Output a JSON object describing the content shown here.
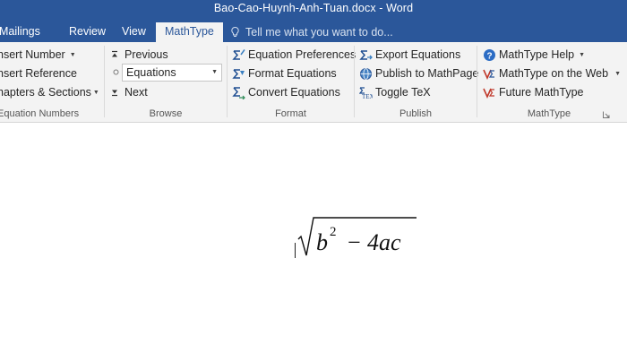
{
  "window": {
    "title": "Bao-Cao-Huynh-Anh-Tuan.docx - Word"
  },
  "tabs": [
    {
      "label": "Mailings",
      "active": false
    },
    {
      "label": "Review",
      "active": false
    },
    {
      "label": "View",
      "active": false
    },
    {
      "label": "MathType",
      "active": true
    }
  ],
  "tell_me": {
    "placeholder": "Tell me what you want to do..."
  },
  "ribbon": {
    "equation_numbers": {
      "label": "Equation Numbers",
      "insert_number": "nsert Number",
      "insert_reference": "nsert Reference",
      "chapters_sections": "hapters & Sections"
    },
    "browse": {
      "label": "Browse",
      "previous": "Previous",
      "select_value": "Equations",
      "next": "Next"
    },
    "format": {
      "label": "Format",
      "equation_preferences": "Equation Preferences",
      "format_equations": "Format Equations",
      "convert_equations": "Convert Equations"
    },
    "publish": {
      "label": "Publish",
      "export_equations": "Export Equations",
      "publish_to_mathpage": "Publish to MathPage",
      "toggle_tex": "Toggle TeX"
    },
    "mathtype": {
      "label": "MathType",
      "help": "MathType Help",
      "on_the_web": "MathType on the Web",
      "future": "Future MathType"
    }
  },
  "document": {
    "equation": {
      "radicand_base": "b",
      "exponent": "2",
      "operator": "−",
      "term": "4ac"
    }
  },
  "colors": {
    "title_bar": "#2b579a",
    "ribbon_bg": "#f3f3f3",
    "document_bg": "#ffffff"
  },
  "icons": [
    "lightbulb-icon",
    "caret-up-icon",
    "circle-icon",
    "caret-down-icon",
    "sigma-icon",
    "globe-icon",
    "tex-icon",
    "help-icon",
    "web-icon",
    "future-icon",
    "dialog-launcher-icon"
  ]
}
